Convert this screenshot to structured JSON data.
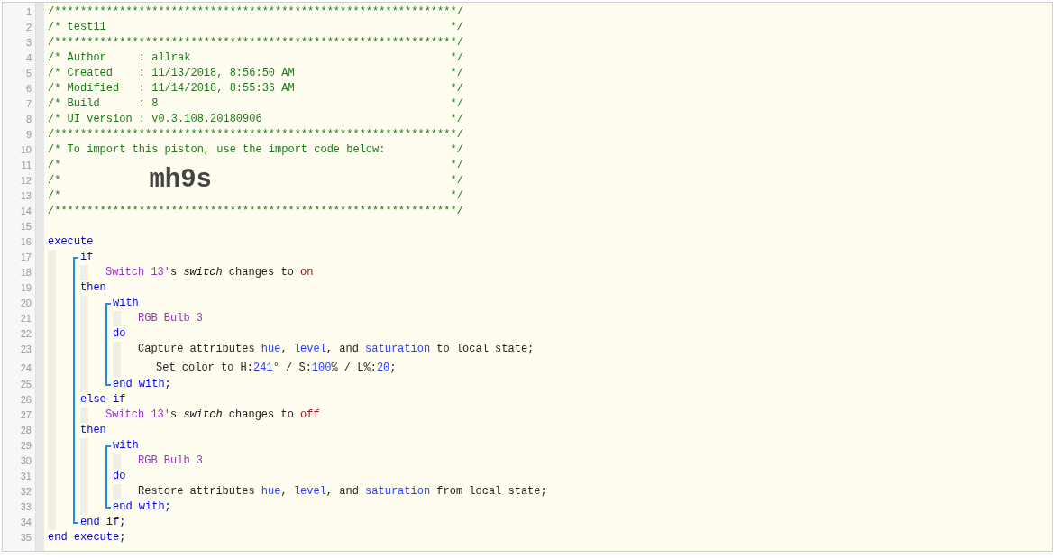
{
  "header": [
    {
      "number": "1",
      "left": "/**************************************************************/"
    },
    {
      "number": "2",
      "left": "/* test11",
      "right": "*/"
    },
    {
      "number": "3",
      "left": "/**************************************************************/"
    },
    {
      "number": "4",
      "left": "/* Author     : allrak",
      "right": "*/"
    },
    {
      "number": "5",
      "left": "/* Created    : 11/13/2018, 8:56:50 AM",
      "right": "*/"
    },
    {
      "number": "6",
      "left": "/* Modified   : 11/14/2018, 8:55:36 AM",
      "right": "*/"
    },
    {
      "number": "7",
      "left": "/* Build      : 8",
      "right": "*/"
    },
    {
      "number": "8",
      "left": "/* UI version : v0.3.108.20180906",
      "right": "*/"
    },
    {
      "number": "9",
      "left": "/**************************************************************/"
    },
    {
      "number": "10",
      "left": "/* To import this piston, use the import code below:",
      "right": "*/"
    },
    {
      "number": "11",
      "left": "/*",
      "right": "*/"
    },
    {
      "number": "12",
      "left": "/*",
      "import_code": "mh9s",
      "right": "*/"
    },
    {
      "number": "13",
      "left": "/*",
      "right": "*/"
    },
    {
      "number": "14",
      "left": "/**************************************************************/"
    },
    {
      "number": "15"
    }
  ],
  "code": [
    {
      "kind": "line",
      "number": "16",
      "segments": [
        {
          "kind": "keyword",
          "text": "execute"
        }
      ],
      "children": [
        {
          "kind": "bracket",
          "children": [
            {
              "kind": "line",
              "number": "17",
              "segments": [
                {
                  "kind": "keyword",
                  "text": "if"
                }
              ],
              "children": [
                {
                  "kind": "line",
                  "number": "18",
                  "segments": [
                    {
                      "kind": "device",
                      "text": "Switch 13'"
                    },
                    {
                      "kind": "plain",
                      "text": "s "
                    },
                    {
                      "kind": "italic",
                      "text": "switch"
                    },
                    {
                      "kind": "plain",
                      "text": " changes to "
                    },
                    {
                      "kind": "literal",
                      "text": "on"
                    }
                  ]
                }
              ]
            },
            {
              "kind": "line",
              "number": "19",
              "segments": [
                {
                  "kind": "keyword",
                  "text": "then"
                }
              ],
              "children": [
                {
                  "kind": "bracket",
                  "children": [
                    {
                      "kind": "line",
                      "number": "20",
                      "segments": [
                        {
                          "kind": "keyword",
                          "text": "with"
                        }
                      ],
                      "children": [
                        {
                          "kind": "line",
                          "number": "21",
                          "segments": [
                            {
                              "kind": "device",
                              "text": "RGB Bulb 3"
                            }
                          ]
                        }
                      ]
                    },
                    {
                      "kind": "line",
                      "number": "22",
                      "segments": [
                        {
                          "kind": "keyword",
                          "text": "do"
                        }
                      ],
                      "children": [
                        {
                          "kind": "line",
                          "number": "23",
                          "segments": [
                            {
                              "kind": "plain",
                              "text": "Capture attributes "
                            },
                            {
                              "kind": "value",
                              "text": "hue"
                            },
                            {
                              "kind": "plain",
                              "text": ", "
                            },
                            {
                              "kind": "value",
                              "text": "level"
                            },
                            {
                              "kind": "plain",
                              "text": ", and "
                            },
                            {
                              "kind": "value",
                              "text": "saturation"
                            },
                            {
                              "kind": "plain",
                              "text": " to local state;"
                            }
                          ]
                        },
                        {
                          "kind": "subline",
                          "number": "24",
                          "segments": [
                            {
                              "kind": "plain",
                              "text": "Set color to H:"
                            },
                            {
                              "kind": "value",
                              "text": "241"
                            },
                            {
                              "kind": "plain",
                              "text": "° / S:"
                            },
                            {
                              "kind": "value",
                              "text": "100"
                            },
                            {
                              "kind": "plain",
                              "text": "% / L%:"
                            },
                            {
                              "kind": "value",
                              "text": "20"
                            },
                            {
                              "kind": "plain",
                              "text": ";"
                            }
                          ]
                        }
                      ]
                    },
                    {
                      "kind": "line",
                      "number": "25",
                      "segments": [
                        {
                          "kind": "keyword",
                          "text": "end with;"
                        }
                      ]
                    }
                  ]
                }
              ]
            },
            {
              "kind": "line",
              "number": "26",
              "segments": [
                {
                  "kind": "keyword",
                  "text": "else if"
                }
              ],
              "children": [
                {
                  "kind": "line",
                  "number": "27",
                  "segments": [
                    {
                      "kind": "device",
                      "text": "Switch 13'"
                    },
                    {
                      "kind": "plain",
                      "text": "s "
                    },
                    {
                      "kind": "italic",
                      "text": "switch"
                    },
                    {
                      "kind": "plain",
                      "text": " changes to "
                    },
                    {
                      "kind": "literal",
                      "text": "off"
                    }
                  ]
                }
              ]
            },
            {
              "kind": "line",
              "number": "28",
              "segments": [
                {
                  "kind": "keyword",
                  "text": "then"
                }
              ],
              "children": [
                {
                  "kind": "bracket",
                  "children": [
                    {
                      "kind": "line",
                      "number": "29",
                      "segments": [
                        {
                          "kind": "keyword",
                          "text": "with"
                        }
                      ],
                      "children": [
                        {
                          "kind": "line",
                          "number": "30",
                          "segments": [
                            {
                              "kind": "device",
                              "text": "RGB Bulb 3"
                            }
                          ]
                        }
                      ]
                    },
                    {
                      "kind": "line",
                      "number": "31",
                      "segments": [
                        {
                          "kind": "keyword",
                          "text": "do"
                        }
                      ],
                      "children": [
                        {
                          "kind": "line",
                          "number": "32",
                          "segments": [
                            {
                              "kind": "plain",
                              "text": "Restore attributes "
                            },
                            {
                              "kind": "value",
                              "text": "hue"
                            },
                            {
                              "kind": "plain",
                              "text": ", "
                            },
                            {
                              "kind": "value",
                              "text": "level"
                            },
                            {
                              "kind": "plain",
                              "text": ", and "
                            },
                            {
                              "kind": "value",
                              "text": "saturation"
                            },
                            {
                              "kind": "plain",
                              "text": " from local state;"
                            }
                          ]
                        }
                      ]
                    },
                    {
                      "kind": "line",
                      "number": "33",
                      "segments": [
                        {
                          "kind": "keyword",
                          "text": "end with;"
                        }
                      ]
                    }
                  ]
                }
              ]
            },
            {
              "kind": "line",
              "number": "34",
              "segments": [
                {
                  "kind": "keyword",
                  "text": "end if;"
                }
              ]
            }
          ]
        }
      ]
    },
    {
      "kind": "line",
      "number": "35",
      "segments": [
        {
          "kind": "keyword",
          "text": "end execute;"
        }
      ]
    }
  ]
}
